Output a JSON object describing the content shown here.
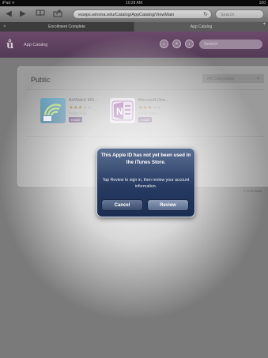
{
  "status_bar": {
    "device": "iPad ᯤ",
    "time": "10:29 AM",
    "battery": "100"
  },
  "browser": {
    "url": "eswps.winona.edu/Catalog/AppCatalog/ViewMain",
    "reload_icon": "reload-icon",
    "search_placeholder": "Search",
    "nav_icons": [
      "back-icon",
      "forward-icon",
      "bookmarks-icon",
      "share-icon"
    ]
  },
  "tabs": [
    {
      "label": "Enrollment Complete",
      "close": "×"
    },
    {
      "label": "App Catalog"
    }
  ],
  "tabs_add": "+",
  "app_header": {
    "logo": "ů",
    "title": "App Catalog",
    "icons": [
      "home-icon",
      "close-icon",
      "info-icon"
    ],
    "search_placeholder": "Search"
  },
  "catalog": {
    "heading": "Public",
    "category_select": "All Categories",
    "apps": [
      {
        "name": "AirWatch MD...",
        "rating": 3,
        "price": "Public Free",
        "action": "Install",
        "icon": "airwatch-icon"
      },
      {
        "name": "Microsoft One...",
        "rating": 3,
        "price": "Public Free",
        "action": "Install",
        "icon": "onenote-icon"
      }
    ],
    "copyright": "© 2012 AirWa"
  },
  "dialog": {
    "title": "This Apple ID has not yet been used in the iTunes Store.",
    "message": "Tap Review to sign in, then review your account information.",
    "cancel_label": "Cancel",
    "review_label": "Review"
  },
  "colors": {
    "header": "#533a55",
    "dialog": "#273b63",
    "install_button": "#3d2250"
  }
}
